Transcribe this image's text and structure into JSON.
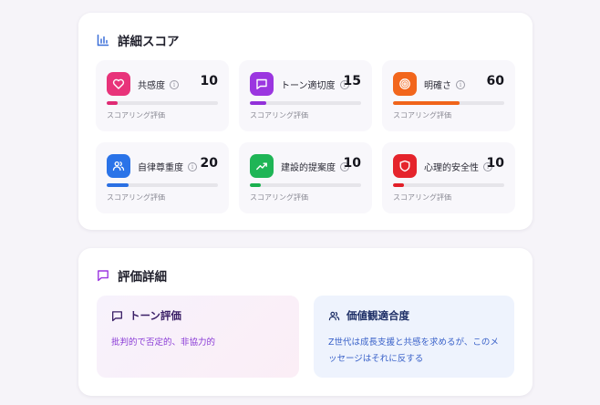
{
  "scores": {
    "title": "詳細スコア",
    "metrics": [
      {
        "label": "共感度",
        "value": "10",
        "progress": 0.1,
        "caption": "スコアリング評価",
        "icon": "heart-icon",
        "color": "#e8337a",
        "bar_color": "#e02a74"
      },
      {
        "label": "トーン適切度",
        "value": "15",
        "progress": 0.15,
        "caption": "スコアリング評価",
        "icon": "message-icon",
        "color": "#9b36e0",
        "bar_color": "#9231d9"
      },
      {
        "label": "明確さ",
        "value": "60",
        "progress": 0.6,
        "caption": "スコアリング評価",
        "icon": "target-icon",
        "color": "#f2661c",
        "bar_color": "#f0641a"
      },
      {
        "label": "自律尊重度",
        "value": "20",
        "progress": 0.2,
        "caption": "スコアリング評価",
        "icon": "users-icon",
        "color": "#2a73e8",
        "bar_color": "#2a6fe3"
      },
      {
        "label": "建設的提案度",
        "value": "10",
        "progress": 0.1,
        "caption": "スコアリング評価",
        "icon": "trending-up-icon",
        "color": "#1fb556",
        "bar_color": "#1ab04f"
      },
      {
        "label": "心理的安全性",
        "value": "10",
        "progress": 0.1,
        "caption": "スコアリング評価",
        "icon": "shield-icon",
        "color": "#e5242c",
        "bar_color": "#e21f28"
      }
    ]
  },
  "details": {
    "title": "評価詳細",
    "tone": {
      "title": "トーン評価",
      "text": "批判的で否定的、非協力的"
    },
    "value_fit": {
      "title": "価値観適合度",
      "text": "Z世代は成長支援と共感を求めるが、このメッセージはそれに反する"
    }
  }
}
